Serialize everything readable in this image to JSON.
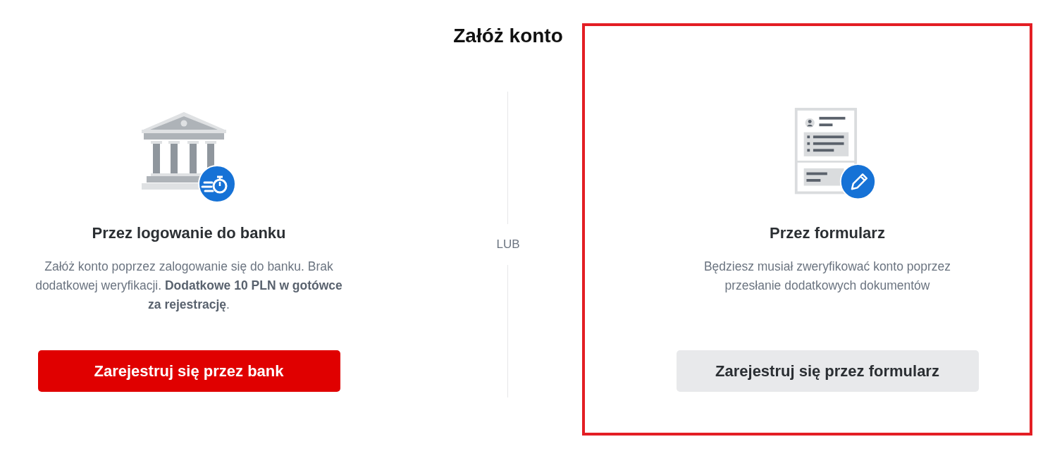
{
  "title": "Załóż konto",
  "options": [
    {
      "kind": "bank",
      "heading": "Przez logowanie do banku",
      "description": "Załóż konto poprzez zalogowanie się do banku. Brak dodatkowej weryfikacji. **Dodatkowe 10 PLN w gotówce za rejestrację**.",
      "button": "Zarejestruj się przez bank",
      "highlighted": false
    },
    {
      "kind": "form",
      "heading": "Przez formularz",
      "description": "Będziesz musiał zweryfikować konto poprzez przesłanie dodatkowych dokumentów",
      "button": "Zarejestruj się przez formularz",
      "highlighted": true
    }
  ],
  "separator": "LUB"
}
